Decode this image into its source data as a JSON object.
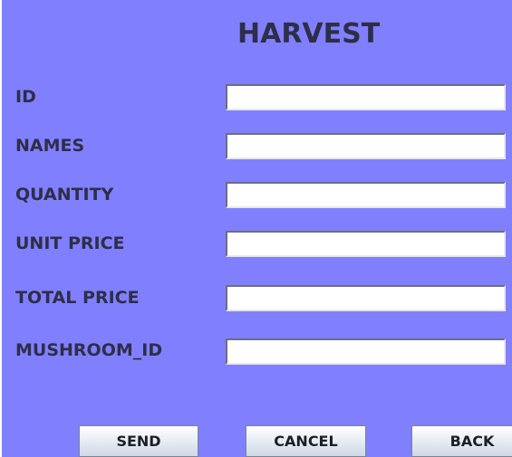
{
  "form": {
    "title": "HARVEST"
  },
  "fields": [
    {
      "label": "ID",
      "value": ""
    },
    {
      "label": "NAMES",
      "value": ""
    },
    {
      "label": "QUANTITY",
      "value": ""
    },
    {
      "label": "UNIT PRICE",
      "value": ""
    },
    {
      "label": "TOTAL PRICE",
      "value": ""
    },
    {
      "label": "MUSHROOM_ID",
      "value": ""
    }
  ],
  "buttons": {
    "send": "SEND",
    "cancel": "CANCEL",
    "back": "BACK"
  },
  "colors": {
    "background": "#8080ff",
    "text": "#2e2e48",
    "field_background": "#ffffff"
  }
}
